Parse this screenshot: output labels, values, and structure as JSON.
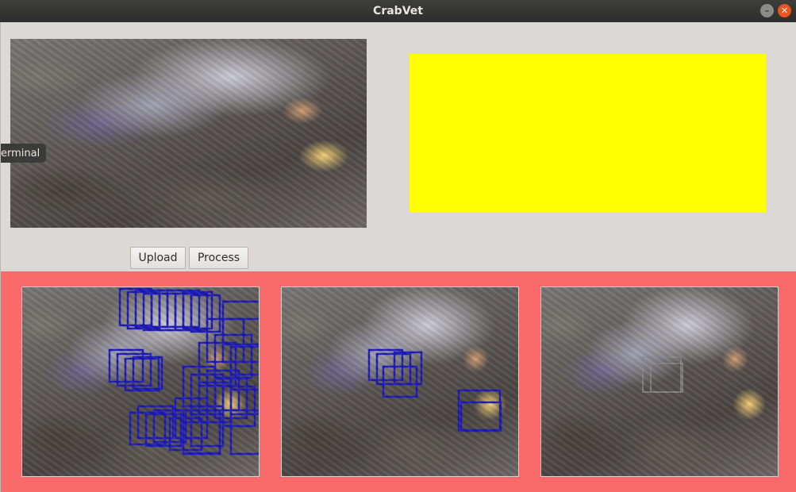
{
  "window": {
    "title": "CrabVet",
    "minimize_glyph": "–",
    "close_glyph": "✕"
  },
  "tooltip": {
    "text": "erminal"
  },
  "buttons": {
    "upload": "Upload",
    "process": "Process"
  },
  "colors": {
    "result_area_background": "#fa6a6a",
    "placeholder_fill": "#ffff00",
    "detection_box": "#1d1ab8",
    "detection_box_faint": "#8a8a8a"
  },
  "icons": [
    "minimize-icon",
    "close-icon"
  ]
}
